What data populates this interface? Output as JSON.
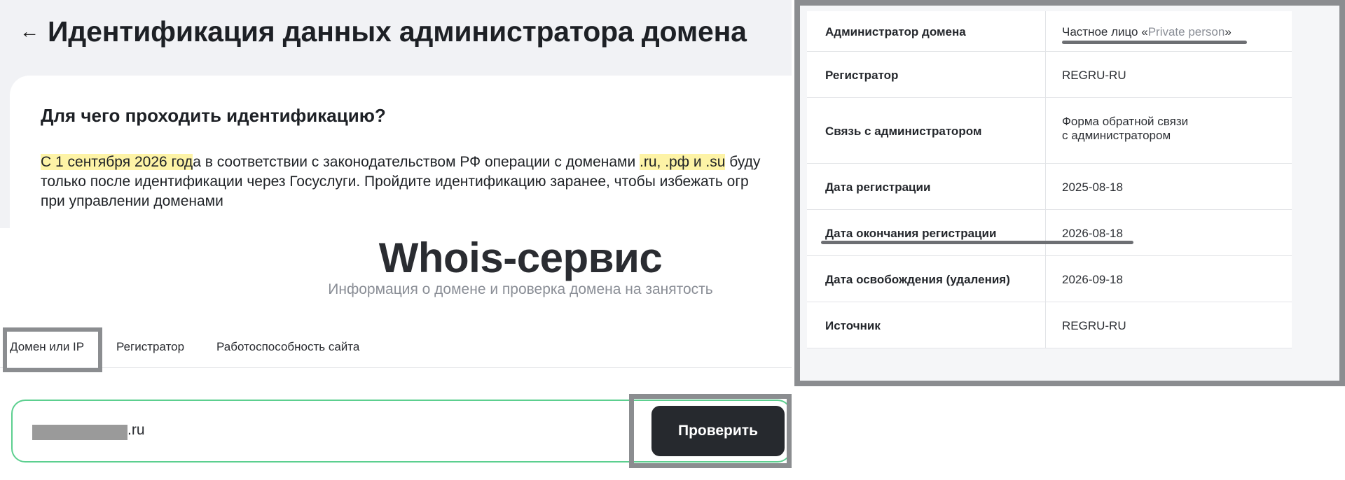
{
  "ident": {
    "back_icon": "arrow-left-icon",
    "title": "Идентификация данных администратора домена",
    "subtitle": "Для чего проходить идентификацию?",
    "text_hl1": "С 1 сентября 2026 год",
    "text_1": "а в соответствии с законодательством РФ операции с доменами ",
    "text_hl2": ".ru, .рф и .su",
    "text_2": " буду",
    "text_line2": "только после идентификации через Госуслуги. Пройдите идентификацию заранее, чтобы избежать огр",
    "text_line3": "при управлении доменами",
    "highlight_color": "#fdf3a6"
  },
  "whois": {
    "title": "Whois-сервис",
    "subtitle": "Информация о домене и проверка домена на занятость",
    "tabs": [
      {
        "label": "Домен или IP"
      },
      {
        "label": "Регистратор"
      },
      {
        "label": "Работоспособность сайта"
      }
    ],
    "search_value_suffix": ".ru",
    "check_button": "Проверить",
    "accent_color": "#5ccf8f"
  },
  "details": {
    "rows": [
      {
        "label": "Администратор домена",
        "value_prefix": "Частное лицо «",
        "value_private": "Private person",
        "value_suffix": "»"
      },
      {
        "label": "Регистратор",
        "value": "REGRU-RU"
      },
      {
        "label": "Связь с администратором",
        "value_line1": "Форма обратной связи",
        "value_line2": "с администратором"
      },
      {
        "label": "Дата регистрации",
        "value": "2025-08-18"
      },
      {
        "label": "Дата окончания регистрации",
        "value": "2026-08-18"
      },
      {
        "label": "Дата освобождения (удаления)",
        "value": "2026-09-18"
      },
      {
        "label": "Источник",
        "value": "REGRU-RU"
      }
    ],
    "link_color": "#2dbb6a"
  }
}
